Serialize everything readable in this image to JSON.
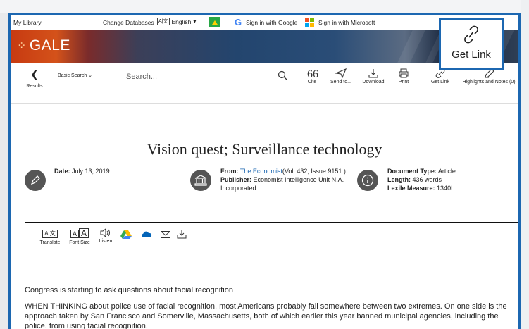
{
  "topbar": {
    "my_library": "My Library",
    "change_databases": "Change Databases",
    "language_icon_text": "A|文",
    "language": "English",
    "sign_in_google": "Sign in with Google",
    "google_glyph": "G",
    "sign_in_microsoft": "Sign in with Microsoft"
  },
  "banner": {
    "logo": "GALE"
  },
  "toolbar": {
    "back_label": "Results",
    "basic_search": "Basic Search ⌄",
    "search_placeholder": "Search...",
    "tools": [
      {
        "label": "Cite"
      },
      {
        "label": "Send to..."
      },
      {
        "label": "Download"
      },
      {
        "label": "Print"
      },
      {
        "label": "Get Link"
      },
      {
        "label": "Highlights and Notes (0)"
      }
    ]
  },
  "highlight_popup": {
    "label": "Get Link"
  },
  "document": {
    "title": "Vision quest; Surveillance technology",
    "date_label": "Date:",
    "date": "July 13, 2019",
    "from_label": "From:",
    "source": "The Economist",
    "source_detail": "(Vol. 432, Issue 9151.)",
    "publisher_label": "Publisher:",
    "publisher": "Economist Intelligence Unit N.A. Incorporated",
    "doc_type_label": "Document Type:",
    "doc_type": "Article",
    "length_label": "Length:",
    "length": "436 words",
    "lexile_label": "Lexile Measure:",
    "lexile": "1340L",
    "actions": {
      "translate": "Translate",
      "translate_icon": "A|文",
      "font_size": "Font Size",
      "font_icon_small": "A",
      "font_icon_large": "A",
      "listen": "Listen"
    },
    "subtitle": "Congress is starting to ask questions about facial recognition",
    "paragraph": "WHEN THINKING about police use of facial recognition, most Americans probably fall somewhere between two extremes. On one side is the approach taken by San Francisco and Somerville, Massachusetts, both of which earlier this year banned municipal agencies, including the police, from using facial recognition."
  },
  "colors": {
    "accent": "#1c67b1",
    "gale_orange": "#d4521a",
    "icon_gray": "#555555"
  }
}
